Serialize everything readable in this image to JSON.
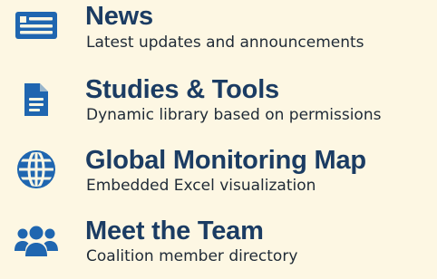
{
  "colors": {
    "background": "#fdf7e3",
    "title": "#1b3c63",
    "subtitle": "#1f2a36",
    "icon": "#1f66b0"
  },
  "menu": {
    "items": [
      {
        "icon": "newspaper-icon",
        "title": "News",
        "subtitle": "Latest updates and announcements"
      },
      {
        "icon": "document-icon",
        "title": "Studies & Tools",
        "subtitle": "Dynamic library based on permissions"
      },
      {
        "icon": "globe-icon",
        "title": "Global Monitoring Map",
        "subtitle": "Embedded Excel visualization"
      },
      {
        "icon": "users-icon",
        "title": "Meet the Team",
        "subtitle": "Coalition member directory"
      }
    ]
  }
}
